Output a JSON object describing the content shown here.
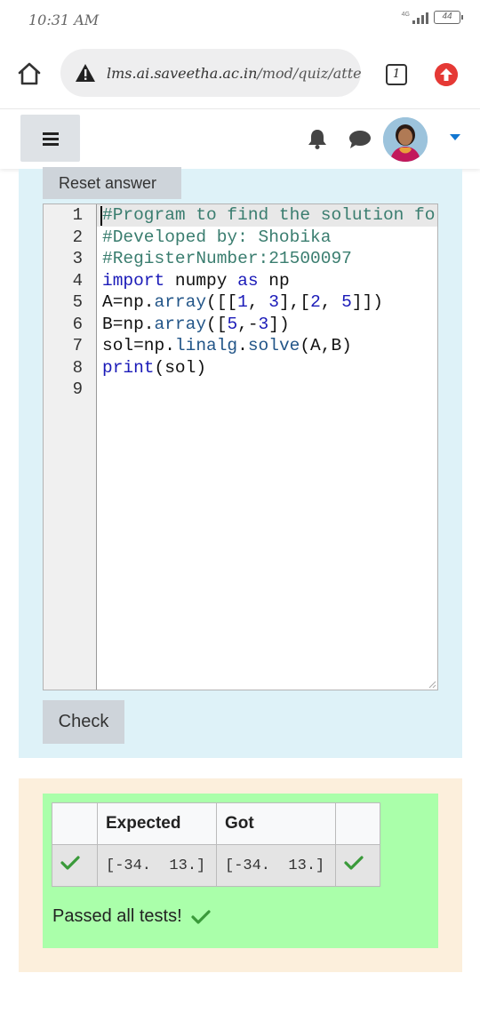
{
  "status_bar": {
    "time": "10:31 AM",
    "network": "4G",
    "battery": "44"
  },
  "browser": {
    "url_host": "lms.ai.saveetha.ac.in",
    "url_path": "/mod/quiz/attem",
    "tab_count": "1",
    "icons": {
      "home": "home-icon",
      "security": "warning-triangle-icon",
      "update": "arrow-up-icon"
    }
  },
  "nav": {
    "icons": {
      "menu": "hamburger-icon",
      "notifications": "bell-icon",
      "messages": "chat-bubble-icon",
      "user_menu": "caret-down-icon"
    }
  },
  "question": {
    "reset_label": "Reset answer",
    "check_label": "Check",
    "line_numbers": [
      "1",
      "2",
      "3",
      "4",
      "5",
      "6",
      "7",
      "8",
      "9"
    ],
    "code": [
      [
        {
          "t": "#Program to find the solution fo",
          "c": "comment"
        }
      ],
      [
        {
          "t": "#Developed by: Shobika",
          "c": "comment"
        }
      ],
      [
        {
          "t": "#RegisterNumber:21500097",
          "c": "comment"
        }
      ],
      [
        {
          "t": "import",
          "c": "keyword"
        },
        {
          "t": " numpy ",
          "c": ""
        },
        {
          "t": "as",
          "c": "keyword"
        },
        {
          "t": " np",
          "c": ""
        }
      ],
      [
        {
          "t": "A=np.",
          "c": ""
        },
        {
          "t": "array",
          "c": "prop"
        },
        {
          "t": "([[",
          "c": ""
        },
        {
          "t": "1",
          "c": "number"
        },
        {
          "t": ", ",
          "c": ""
        },
        {
          "t": "3",
          "c": "number"
        },
        {
          "t": "],[",
          "c": ""
        },
        {
          "t": "2",
          "c": "number"
        },
        {
          "t": ", ",
          "c": ""
        },
        {
          "t": "5",
          "c": "number"
        },
        {
          "t": "]])",
          "c": ""
        }
      ],
      [
        {
          "t": "B=np.",
          "c": ""
        },
        {
          "t": "array",
          "c": "prop"
        },
        {
          "t": "([",
          "c": ""
        },
        {
          "t": "5",
          "c": "number"
        },
        {
          "t": ",-",
          "c": ""
        },
        {
          "t": "3",
          "c": "number"
        },
        {
          "t": "])",
          "c": ""
        }
      ],
      [
        {
          "t": "sol=np.",
          "c": ""
        },
        {
          "t": "linalg",
          "c": "prop"
        },
        {
          "t": ".",
          "c": ""
        },
        {
          "t": "solve",
          "c": "prop"
        },
        {
          "t": "(A,B)",
          "c": ""
        }
      ],
      [
        {
          "t": "print",
          "c": "keyword"
        },
        {
          "t": "(sol)",
          "c": ""
        }
      ],
      []
    ]
  },
  "feedback": {
    "headers": [
      "",
      "Expected",
      "Got",
      ""
    ],
    "rows": [
      {
        "expected": "[-34.  13.]",
        "got": "[-34.  13.]",
        "status": "check-icon"
      }
    ],
    "summary": "Passed all tests!",
    "colors": {
      "result_bg": "#aaffaa",
      "panel_bg": "#fcefdc",
      "tick": "#3a9a3a"
    }
  },
  "colors": {
    "question_panel": "#def2f8",
    "button_gray": "#ced4da",
    "accent_blue": "#1177d1",
    "update_red": "#e53935"
  }
}
